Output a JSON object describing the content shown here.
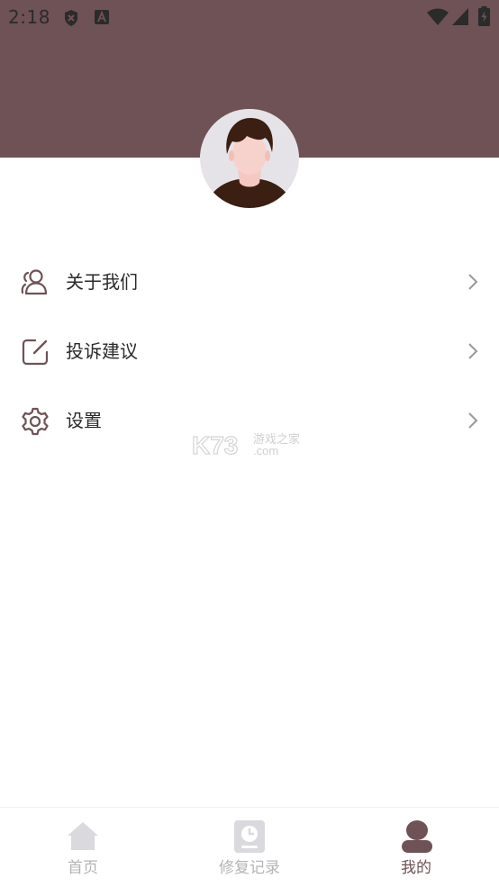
{
  "status_bar": {
    "time": "2:18",
    "icons": [
      "shield-x-icon",
      "font-a-icon",
      "wifi-icon",
      "signal-icon",
      "battery-charging-icon"
    ]
  },
  "colors": {
    "header_bg": "#6e5256",
    "accent": "#6e5256",
    "tab_inactive": "#b4b4b8",
    "text": "#2a2a2a"
  },
  "profile": {
    "avatar_icon": "user-avatar-icon"
  },
  "menu": {
    "items": [
      {
        "label": "关于我们",
        "icon": "users-icon"
      },
      {
        "label": "投诉建议",
        "icon": "edit-icon"
      },
      {
        "label": "设置",
        "icon": "gear-icon"
      }
    ]
  },
  "watermark": {
    "brand": "K73",
    "text": "游戏之家",
    "domain": ".com"
  },
  "tabbar": {
    "tabs": [
      {
        "label": "首页",
        "icon": "home-icon",
        "active": false
      },
      {
        "label": "修复记录",
        "icon": "clock-record-icon",
        "active": false
      },
      {
        "label": "我的",
        "icon": "profile-icon",
        "active": true
      }
    ]
  }
}
